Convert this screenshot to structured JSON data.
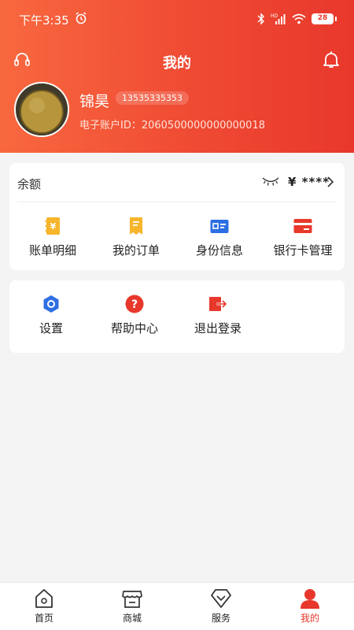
{
  "status_bar": {
    "time": "下午3:35",
    "battery": "28"
  },
  "header": {
    "title": "我的"
  },
  "profile": {
    "name": "锦昊",
    "phone": "13535335353",
    "account_id": "电子账户ID：2060500000000000018"
  },
  "balance": {
    "label": "余额",
    "value": "¥ ****"
  },
  "quick_actions": [
    {
      "label": "账单明细",
      "icon": "bill-icon"
    },
    {
      "label": "我的订单",
      "icon": "order-icon"
    },
    {
      "label": "身份信息",
      "icon": "id-card-icon"
    },
    {
      "label": "银行卡管理",
      "icon": "bank-card-icon"
    }
  ],
  "settings_actions": [
    {
      "label": "设置",
      "icon": "settings-icon"
    },
    {
      "label": "帮助中心",
      "icon": "help-icon"
    },
    {
      "label": "退出登录",
      "icon": "logout-icon"
    }
  ],
  "tabs": [
    {
      "label": "首页",
      "icon": "home-icon"
    },
    {
      "label": "商城",
      "icon": "store-icon"
    },
    {
      "label": "服务",
      "icon": "service-icon"
    },
    {
      "label": "我的",
      "icon": "profile-icon",
      "active": true
    }
  ],
  "colors": {
    "brand": "#e8382c",
    "accent_orange": "#f8683f",
    "icon_yellow": "#f6b52b",
    "icon_blue": "#2d6fe3"
  }
}
